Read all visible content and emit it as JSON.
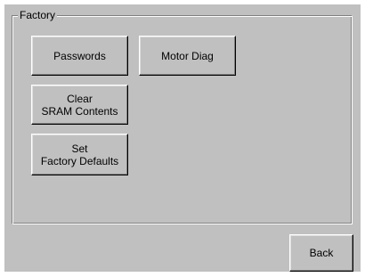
{
  "group": {
    "title": "Factory"
  },
  "buttons": {
    "passwords": "Passwords",
    "motor_diag": "Motor Diag",
    "clear_sram": "Clear\nSRAM Contents",
    "factory_defaults": "Set\nFactory Defaults",
    "back": "Back"
  }
}
